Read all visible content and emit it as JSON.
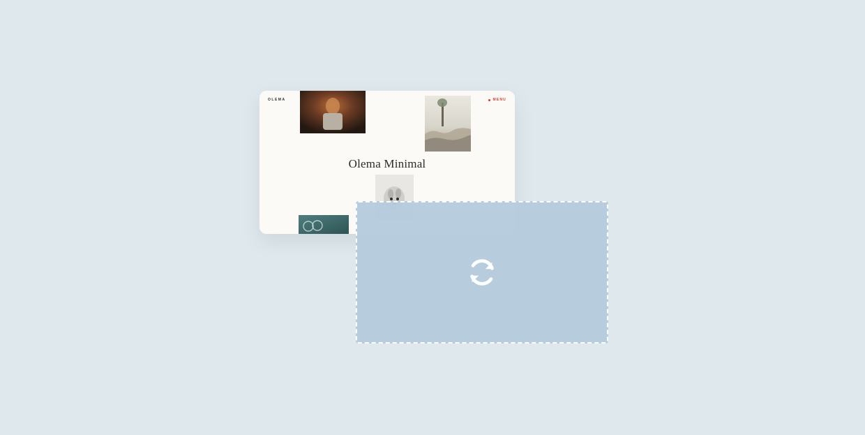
{
  "card": {
    "logo": "OLEMA",
    "menu_label": "MENU",
    "title": "Olema Minimal"
  },
  "overlay": {
    "icon_name": "refresh-icon"
  },
  "colors": {
    "page_bg": "#DFE8ED",
    "card_bg": "#FBFAF7",
    "overlay_bg": "#B6CCDD",
    "accent": "#d23c2a"
  }
}
